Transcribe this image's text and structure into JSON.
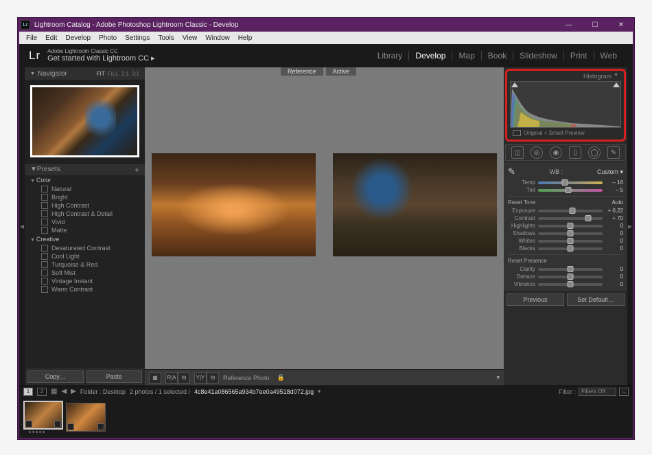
{
  "window": {
    "title": "Lightroom Catalog - Adobe Photoshop Lightroom Classic - Develop"
  },
  "menubar": [
    "File",
    "Edit",
    "Develop",
    "Photo",
    "Settings",
    "Tools",
    "View",
    "Window",
    "Help"
  ],
  "header": {
    "logo": "Lr",
    "line1": "Adobe Lightroom Classic CC",
    "line2": "Get started with Lightroom CC  ▸",
    "modules": [
      "Library",
      "Develop",
      "Map",
      "Book",
      "Slideshow",
      "Print",
      "Web"
    ],
    "active_module": "Develop"
  },
  "navigator": {
    "title": "Navigator",
    "options": [
      "FIT",
      "FILL",
      "1:1",
      "3:1"
    ],
    "selected": "FIT"
  },
  "presets": {
    "title": "Presets",
    "groups": [
      {
        "name": "Color",
        "items": [
          "Natural",
          "Bright",
          "High Contrast",
          "High Contrast & Detail",
          "Vivid",
          "Matte"
        ]
      },
      {
        "name": "Creative",
        "items": [
          "Desaturated Contrast",
          "Cool Light",
          "Turquoise & Red",
          "Soft Mist",
          "Vintage Instant",
          "Warm Contrast"
        ]
      }
    ],
    "copy": "Copy…",
    "paste": "Paste"
  },
  "compare": {
    "reference_label": "Reference",
    "active_label": "Active",
    "toolbar": {
      "reference_photo": "Reference Photo :"
    }
  },
  "histogram": {
    "title": "Histogram",
    "label": "Original + Smart Preview"
  },
  "basic": {
    "wb_label": "WB :",
    "wb_value": "Custom",
    "temp": {
      "label": "Temp",
      "value": "– 16",
      "pos": 42
    },
    "tint": {
      "label": "Tint",
      "value": "– 5",
      "pos": 47
    },
    "tone_label": "Reset Tone",
    "auto": "Auto",
    "exposure": {
      "label": "Exposure",
      "value": "+ 0,22",
      "pos": 53
    },
    "contrast": {
      "label": "Contrast",
      "value": "+ 70",
      "pos": 78
    },
    "highlights": {
      "label": "Highlights",
      "value": "0",
      "pos": 50
    },
    "shadows": {
      "label": "Shadows",
      "value": "0",
      "pos": 50
    },
    "whites": {
      "label": "Whites",
      "value": "0",
      "pos": 50
    },
    "blacks": {
      "label": "Blacks",
      "value": "0",
      "pos": 50
    },
    "presence_label": "Reset Presence",
    "clarity": {
      "label": "Clarity",
      "value": "0",
      "pos": 50
    },
    "dehaze": {
      "label": "Dehaze",
      "value": "0",
      "pos": 50
    },
    "vibrance": {
      "label": "Vibrance",
      "value": "0",
      "pos": 50
    }
  },
  "prev_default": {
    "previous": "Previous",
    "set_default": "Set Default…"
  },
  "filmstrip": {
    "nums": [
      "1",
      "2"
    ],
    "folder": "Folder : Desktop",
    "count": "2 photos / 1 selected /",
    "filename": "4c8e41a086565a934b7ee0a49518d072.jpg",
    "filter": "Filter :",
    "filter_value": "Filters Off"
  }
}
